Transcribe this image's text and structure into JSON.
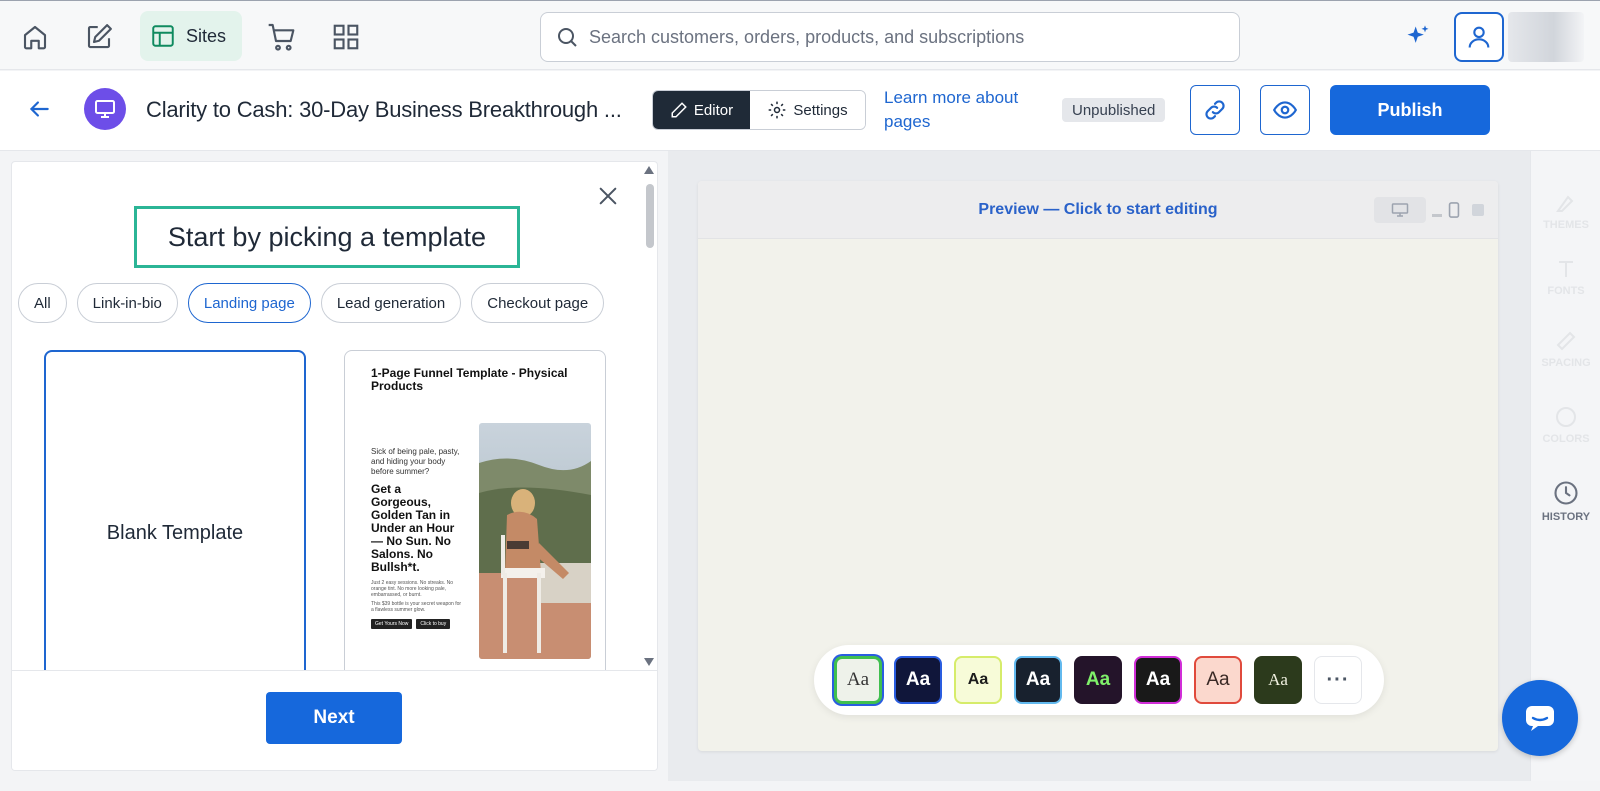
{
  "topnav": {
    "sites_label": "Sites",
    "search_placeholder": "Search customers, orders, products, and subscriptions"
  },
  "pagebar": {
    "title": "Clarity to Cash: 30-Day Business Breakthrough ...",
    "editor_label": "Editor",
    "settings_label": "Settings",
    "learn_more": "Learn more about pages",
    "status": "Unpublished",
    "publish_label": "Publish"
  },
  "panel": {
    "heading": "Start by picking a template",
    "filters": [
      {
        "label": "All",
        "active": false
      },
      {
        "label": "Link-in-bio",
        "active": false
      },
      {
        "label": "Landing page",
        "active": true
      },
      {
        "label": "Lead generation",
        "active": false
      },
      {
        "label": "Checkout page",
        "active": false
      }
    ],
    "blank_label": "Blank Template",
    "template": {
      "title": "1-Page Funnel Template - Physical Products",
      "intro": "Sick of being pale, pasty, and hiding your body before summer?",
      "headline": "Get a Gorgeous, Golden Tan in Under an Hour — No Sun. No Salons. No Bullsh*t.",
      "body1": "Just 2 easy sessions. No streaks. No orange tint. No more looking pale, embarrassed, or burnt.",
      "body2": "This $39 bottle is your secret weapon for a flawless summer glow.",
      "btn1": "Get Yours Now",
      "btn2": "Click to buy"
    },
    "next_label": "Next"
  },
  "preview": {
    "label": "Preview — Click to start editing"
  },
  "themes": [
    {
      "bg": "#eef2ea",
      "fg": "#333333",
      "border": "#3fbf4f",
      "serif": true
    },
    {
      "bg": "#10163a",
      "fg": "#ffffff",
      "border": "#2a5de0",
      "serif": false
    },
    {
      "bg": "#f7fbd8",
      "fg": "#1c1c1c",
      "border": "#d6ec6a",
      "serif": false
    },
    {
      "bg": "#18212e",
      "fg": "#ffffff",
      "border": "#62b9ee",
      "serif": false
    },
    {
      "bg": "#24142a",
      "fg": "#7ff06a",
      "border": "#24142a",
      "serif": false
    },
    {
      "bg": "#191919",
      "fg": "#ffffff",
      "border": "#d12ed8",
      "serif": false
    },
    {
      "bg": "#fbd8cd",
      "fg": "#3a2a26",
      "border": "#e04a3c",
      "serif": false
    },
    {
      "bg": "#2c3a1c",
      "fg": "#f0f0e0",
      "border": "#2c3a1c",
      "serif": true
    }
  ],
  "theme_text": "Aa",
  "more_label": "···",
  "rail": [
    {
      "label": "THEMES",
      "icon": "themes-icon",
      "active": false
    },
    {
      "label": "FONTS",
      "icon": "fonts-icon",
      "active": false
    },
    {
      "label": "SPACING",
      "icon": "spacing-icon",
      "active": false
    },
    {
      "label": "COLORS",
      "icon": "colors-icon",
      "active": false
    },
    {
      "label": "HISTORY",
      "icon": "history-icon",
      "active": true
    }
  ]
}
